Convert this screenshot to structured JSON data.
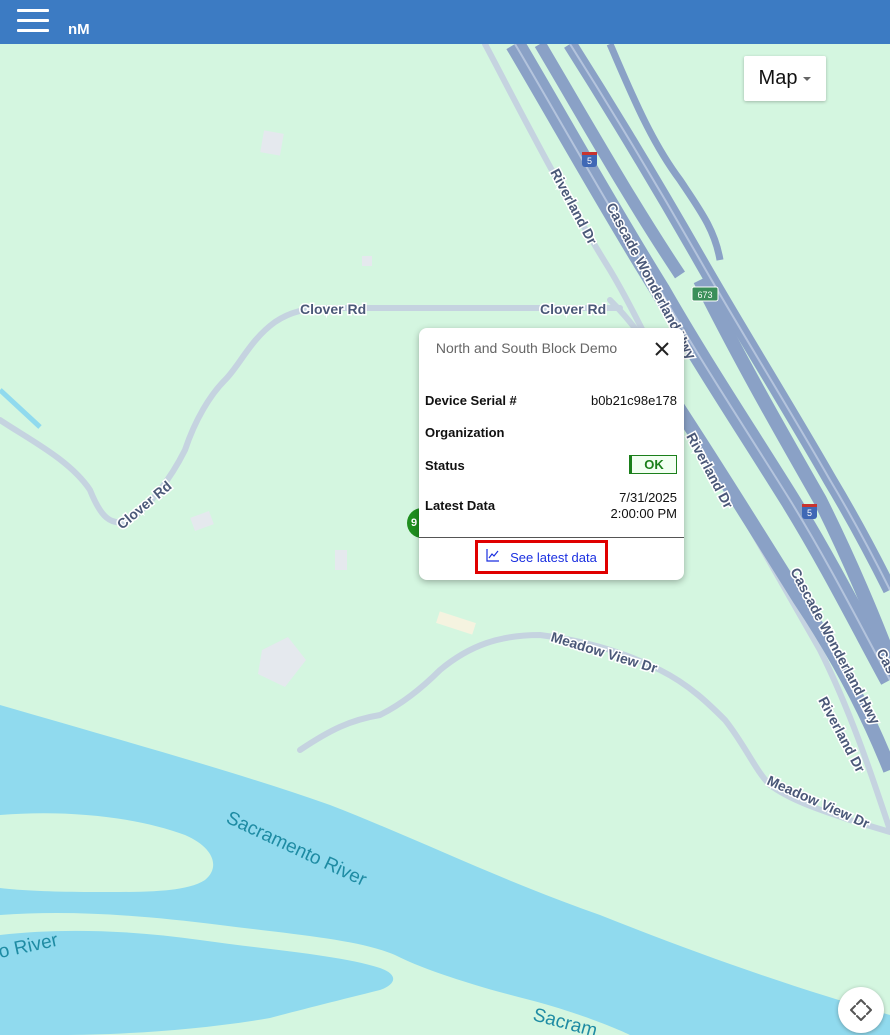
{
  "app": {
    "title": "nM"
  },
  "map": {
    "type_selector": "Map",
    "labels": {
      "riverland_1": "Riverland Dr",
      "riverland_2": "Riverland Dr",
      "riverland_3": "Riverland Dr",
      "cascade_1": "Cascade Wonderland Hwy",
      "cascade_2": "Cascade Wonderland Hwy",
      "cascade_3": "Cas",
      "clover_1": "Clover Rd",
      "clover_2": "Clover Rd",
      "clover_3": "Clover Rd",
      "meadow_1": "Meadow View Dr",
      "meadow_2": "Meadow View Dr",
      "river_1": "Sacramento River",
      "river_2": "o River",
      "river_3": "Sacram",
      "shield_673": "673",
      "shield_5a": "5",
      "shield_5b": "5"
    },
    "marker_label": "9"
  },
  "popup": {
    "title": "North and South Block Demo",
    "rows": [
      {
        "key": "Device Serial #",
        "value": "b0b21c98e178"
      },
      {
        "key": "Organization",
        "value": ""
      },
      {
        "key": "Status",
        "value": "OK"
      },
      {
        "key": "Latest Data",
        "value_line1": "7/31/2025",
        "value_line2": "2:00:00 PM"
      }
    ],
    "see_latest": "See latest data"
  },
  "colors": {
    "header": "#3c7bc3",
    "map_bg": "#d4f6e0",
    "water": "#90daee",
    "highway": "#8aa1c6",
    "road": "#c5d3e0",
    "status_ok": "#1b7f1b",
    "link": "#1a2fe0",
    "highlight": "#e00000"
  }
}
